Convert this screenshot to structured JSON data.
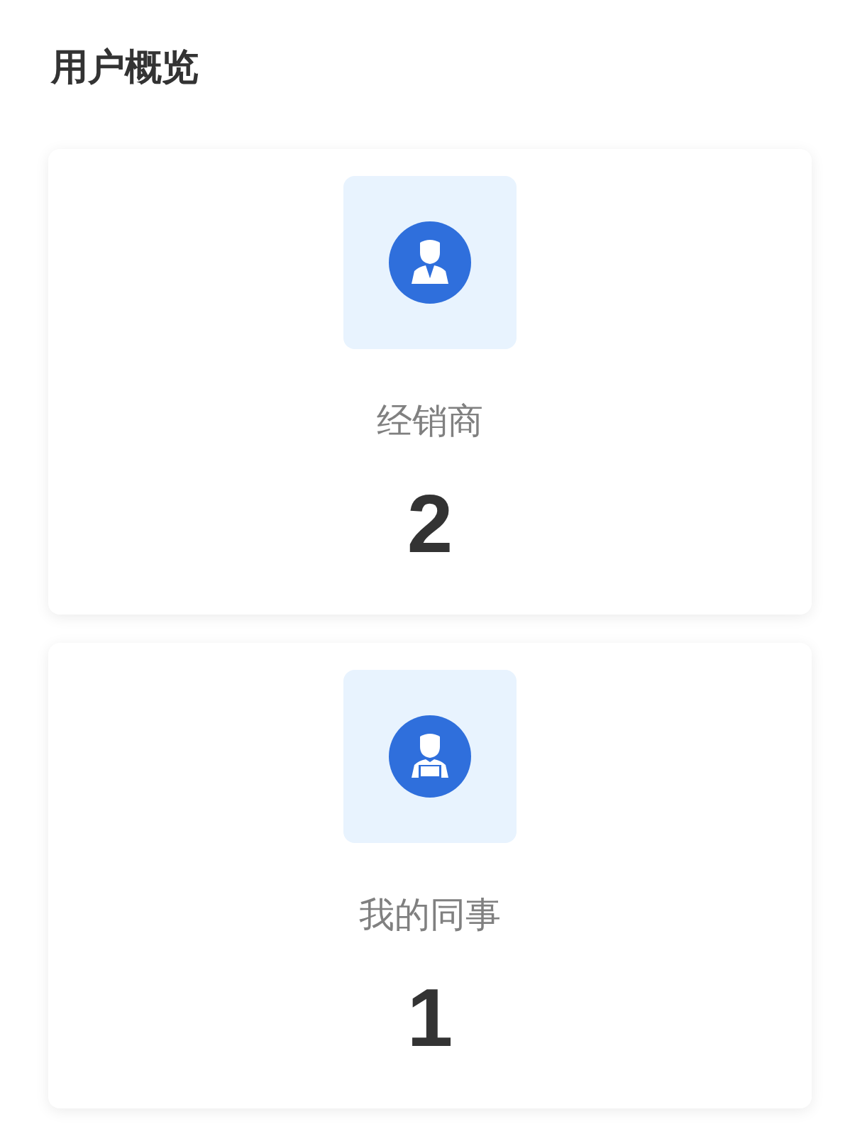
{
  "title": "用户概览",
  "cards": [
    {
      "kind": "business",
      "label": "经销商",
      "count": "2"
    },
    {
      "kind": "laptop",
      "label": "我的同事",
      "count": "1"
    }
  ]
}
